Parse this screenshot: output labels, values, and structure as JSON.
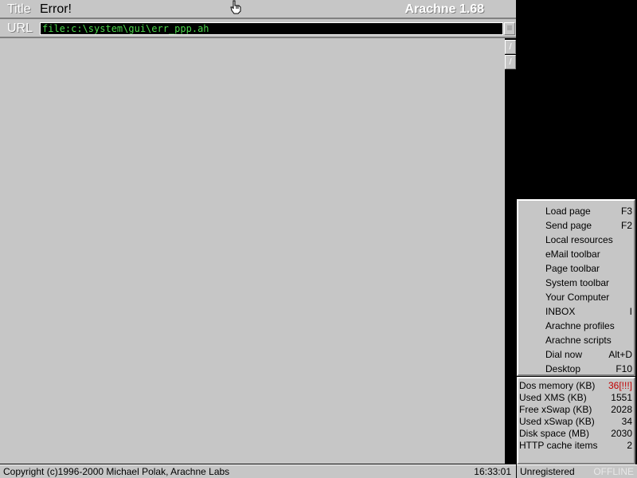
{
  "window": {
    "title_label": "Title",
    "title_value": "Error!",
    "brand": "Arachne 1.68"
  },
  "url": {
    "label": "URL",
    "value": "file:c:\\system\\gui\\err_ppp.ah",
    "menu_icon": "hamburger-icon"
  },
  "scrollbar": {
    "up_icon": "scroll-up-icon",
    "down_icon": "scroll-down-icon"
  },
  "menu": {
    "items": [
      {
        "label": "Load page",
        "key": "F3"
      },
      {
        "label": "Send page",
        "key": "F2"
      },
      {
        "label": "Local resources",
        "key": ""
      },
      {
        "label": "eMail toolbar",
        "key": ""
      },
      {
        "label": "Page toolbar",
        "key": ""
      },
      {
        "label": "System toolbar",
        "key": ""
      },
      {
        "label": "Your Computer",
        "key": ""
      },
      {
        "label": "INBOX",
        "key": "I"
      },
      {
        "label": "Arachne profiles",
        "key": ""
      },
      {
        "label": "Arachne scripts",
        "key": ""
      },
      {
        "label": "Dial now",
        "key": "Alt+D"
      },
      {
        "label": "Desktop",
        "key": "F10"
      }
    ]
  },
  "stats": {
    "rows": [
      {
        "label": "Dos memory (KB)",
        "value": "36[!!!]"
      },
      {
        "label": "Used XMS (KB)",
        "value": "1551"
      },
      {
        "label": "Free xSwap (KB)",
        "value": "2028"
      },
      {
        "label": "Used xSwap (KB)",
        "value": "34"
      },
      {
        "label": "Disk space (MB)",
        "value": "2030"
      },
      {
        "label": "HTTP cache items",
        "value": "2"
      }
    ],
    "warn_color": "#c00000"
  },
  "status": {
    "copyright": "Copyright (c)1996-2000 Michael Polak, Arachne Labs",
    "clock": "16:33:01",
    "registration": "Unregistered",
    "connection": "OFFLINE"
  },
  "colors": {
    "panel": "#c6c6c6",
    "url_text": "#4cd84c",
    "background": "#000000"
  }
}
